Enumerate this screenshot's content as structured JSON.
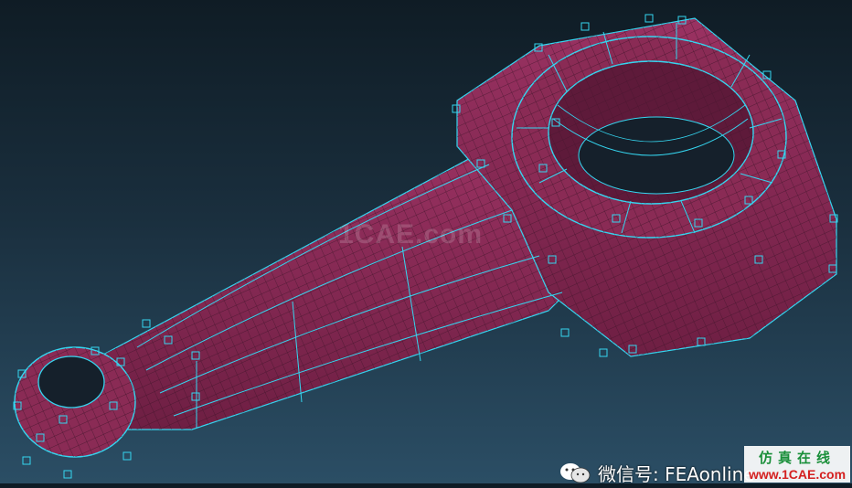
{
  "watermark": {
    "center": "1CAE.com",
    "account": "微信号: FEAonline",
    "logo_top": "仿真在线",
    "logo_bottom": "www.1CAE.com"
  },
  "icons": {
    "wechat": "wechat-icon"
  },
  "colors": {
    "mesh_fill": "#8a2b55",
    "mesh_edge": "#35d6f0",
    "background_top": "#0f1c25",
    "background_bottom": "#2b4e65"
  }
}
